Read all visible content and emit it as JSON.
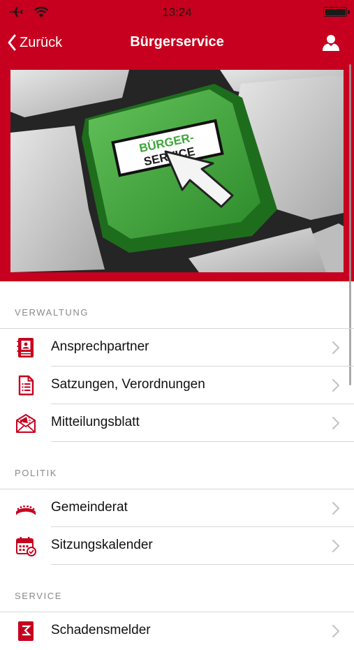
{
  "status_bar": {
    "time": "13:24"
  },
  "nav": {
    "back_label": "Zurück",
    "title": "Bürgerservice"
  },
  "hero": {
    "key_line1": "BÜRGER-",
    "key_line2": "SERVICE"
  },
  "sections": {
    "verwaltung": {
      "title": "VERWALTUNG",
      "items": [
        "Ansprechpartner",
        "Satzungen, Verordnungen",
        "Mitteilungsblatt"
      ]
    },
    "politik": {
      "title": "POLITIK",
      "items": [
        "Gemeinderat",
        "Sitzungskalender"
      ]
    },
    "service": {
      "title": "SERVICE",
      "items": [
        "Schadensmelder"
      ]
    }
  },
  "colors": {
    "brand": "#c6001e",
    "key_green": "#3da63a",
    "text": "#111111",
    "section": "#8a8a8f"
  },
  "icons": [
    "airplane-icon",
    "wifi-icon",
    "battery-icon",
    "chevron-left-icon",
    "user-icon",
    "contact-book-icon",
    "document-icon",
    "megaphone-mail-icon",
    "council-icon",
    "calendar-icon",
    "chevron-right-icon"
  ]
}
